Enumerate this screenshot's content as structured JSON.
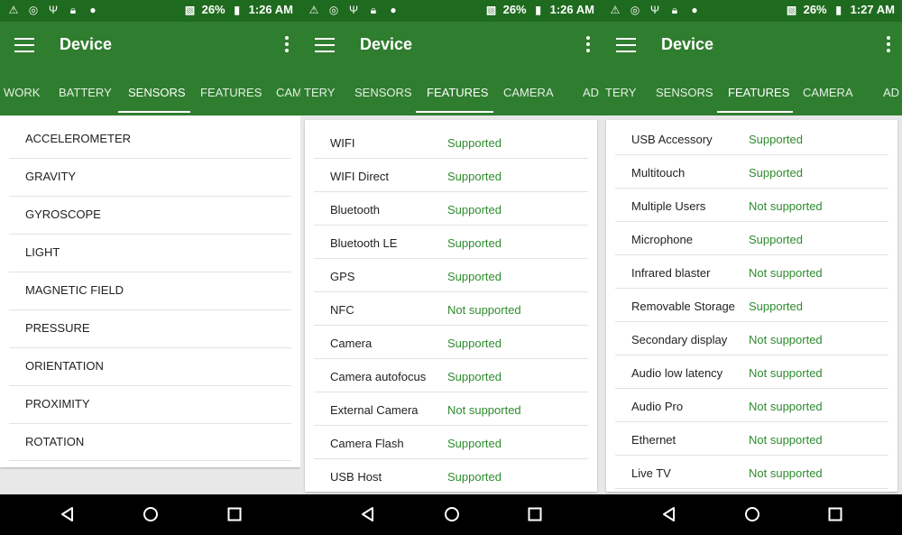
{
  "screens": [
    {
      "status": {
        "battery": "26%",
        "time": "1:26 AM"
      },
      "appbar": {
        "title": "Device"
      },
      "tabs": [
        "WORK",
        "BATTERY",
        "SENSORS",
        "FEATURES",
        "CAM"
      ],
      "active_tab": "SENSORS",
      "sensors": [
        "ACCELEROMETER",
        "GRAVITY",
        "GYROSCOPE",
        "LIGHT",
        "MAGNETIC FIELD",
        "PRESSURE",
        "ORIENTATION",
        "PROXIMITY",
        "ROTATION"
      ]
    },
    {
      "status": {
        "battery": "26%",
        "time": "1:26 AM"
      },
      "appbar": {
        "title": "Device"
      },
      "tabs": [
        "TERY",
        "SENSORS",
        "FEATURES",
        "CAMERA",
        "AD"
      ],
      "active_tab": "FEATURES",
      "features": [
        {
          "name": "WIFI",
          "status": "Supported"
        },
        {
          "name": "WIFI Direct",
          "status": "Supported"
        },
        {
          "name": "Bluetooth",
          "status": "Supported"
        },
        {
          "name": "Bluetooth LE",
          "status": "Supported"
        },
        {
          "name": "GPS",
          "status": "Supported"
        },
        {
          "name": "NFC",
          "status": "Not supported"
        },
        {
          "name": "Camera",
          "status": "Supported"
        },
        {
          "name": "Camera autofocus",
          "status": "Supported"
        },
        {
          "name": "External Camera",
          "status": "Not supported"
        },
        {
          "name": "Camera Flash",
          "status": "Supported"
        },
        {
          "name": "USB Host",
          "status": "Supported"
        }
      ]
    },
    {
      "status": {
        "battery": "26%",
        "time": "1:27 AM"
      },
      "appbar": {
        "title": "Device"
      },
      "tabs": [
        "TERY",
        "SENSORS",
        "FEATURES",
        "CAMERA",
        "AD"
      ],
      "active_tab": "FEATURES",
      "features": [
        {
          "name": "USB Accessory",
          "status": "Supported"
        },
        {
          "name": "Multitouch",
          "status": "Supported"
        },
        {
          "name": "Multiple Users",
          "status": "Not supported"
        },
        {
          "name": "Microphone",
          "status": "Supported"
        },
        {
          "name": "Infrared blaster",
          "status": "Not supported"
        },
        {
          "name": "Removable Storage",
          "status": "Supported"
        },
        {
          "name": "Secondary display",
          "status": "Not supported"
        },
        {
          "name": "Audio low latency",
          "status": "Not supported"
        },
        {
          "name": "Audio Pro",
          "status": "Not supported"
        },
        {
          "name": "Ethernet",
          "status": "Not supported"
        },
        {
          "name": "Live TV",
          "status": "Not supported"
        }
      ]
    }
  ],
  "icons": {
    "status_left": [
      "warning-icon",
      "speed-icon",
      "usb-icon",
      "lock-icon",
      "android-icon"
    ],
    "status_right": [
      "no-sim-icon",
      "battery-charging-icon"
    ],
    "nav": [
      "back-icon",
      "home-icon",
      "recents-icon"
    ]
  },
  "colors": {
    "status_bar": "#1e6a1e",
    "app_bar": "#2f7d2f",
    "supported_text": "#2e8b2e"
  }
}
